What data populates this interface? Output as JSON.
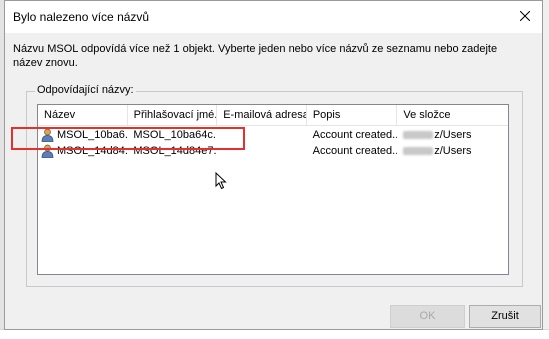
{
  "dialog": {
    "title": "Bylo nalezeno více názvů",
    "message": "Názvu MSOL odpovídá více než 1 objekt. Vyberte jeden nebo více názvů ze seznamu nebo zadejte název znovu.",
    "group_label": "Odpovídající názvy:"
  },
  "list": {
    "columns": [
      "Název",
      "Přihlašovací jmé...",
      "E-mailová adresa",
      "Popis",
      "Ve složce"
    ],
    "rows": [
      {
        "name": "MSOL_10ba6...",
        "login": "MSOL_10ba64c...",
        "email": "",
        "description": "Account created...",
        "folder": "z/Users",
        "selected": true
      },
      {
        "name": "MSOL_14d84...",
        "login": "MSOL_14d84e7...",
        "email": "",
        "description": "Account created...",
        "folder": "z/Users",
        "selected": false
      }
    ]
  },
  "buttons": {
    "ok": "OK",
    "cancel": "Zrušit"
  },
  "icons": {
    "row": "user-icon",
    "close": "close-icon",
    "cursor": "mouse-cursor-icon"
  },
  "colors": {
    "highlight": "#e53030",
    "accent": "#0078d7"
  }
}
